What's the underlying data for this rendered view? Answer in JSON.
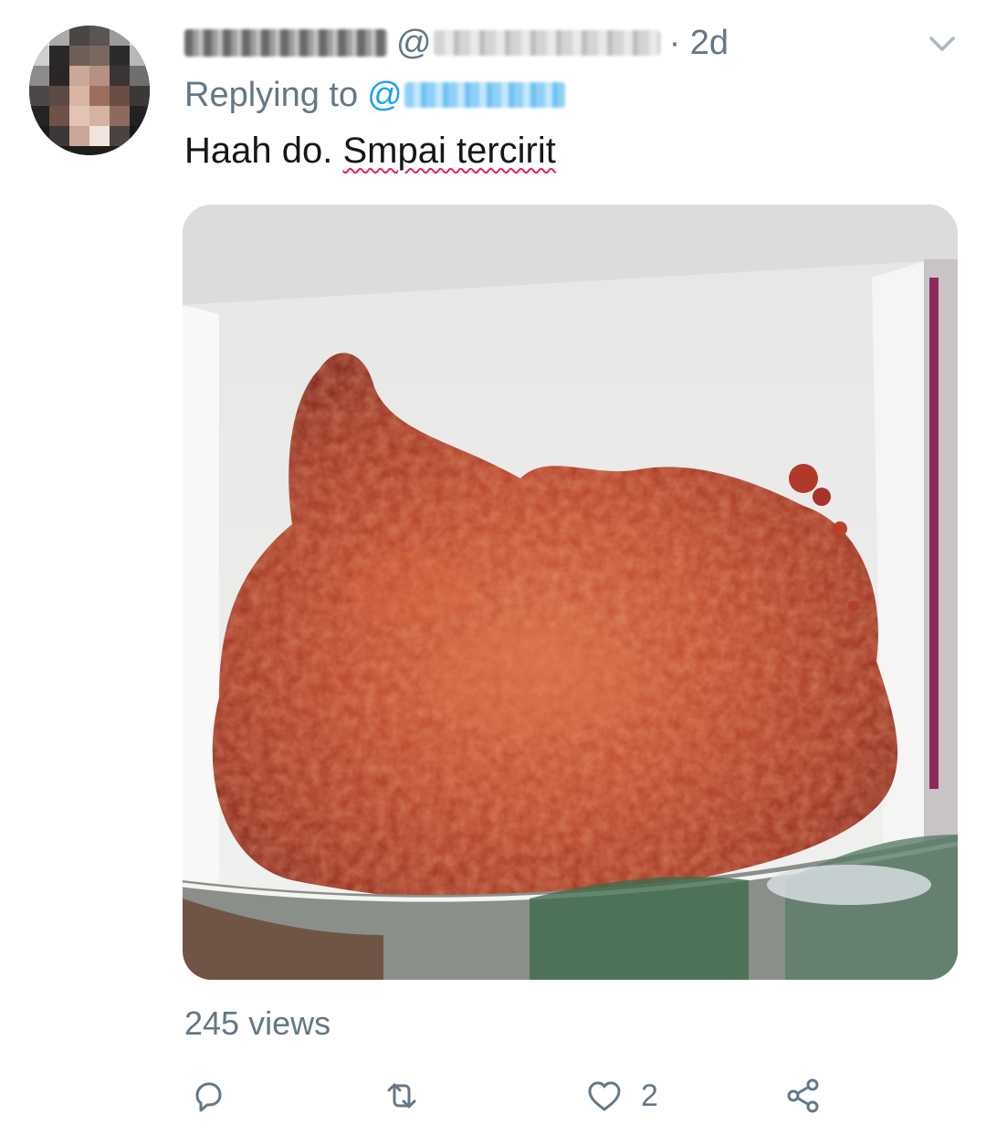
{
  "tweet": {
    "handle_at": "@",
    "time": "· 2d",
    "replying_label": "Replying to",
    "replying_at": "@",
    "text_plain": "Haah do. ",
    "text_underlined": "Smpai tercirit",
    "views": "245 views"
  },
  "actions": {
    "reply_icon": "reply-icon",
    "retweet_icon": "retweet-icon",
    "like_icon": "heart-icon",
    "like_count": "2",
    "share_icon": "share-icon"
  },
  "colors": {
    "secondary_text": "#657786",
    "link": "#1da1f2",
    "spellcheck": "#e0245e"
  }
}
